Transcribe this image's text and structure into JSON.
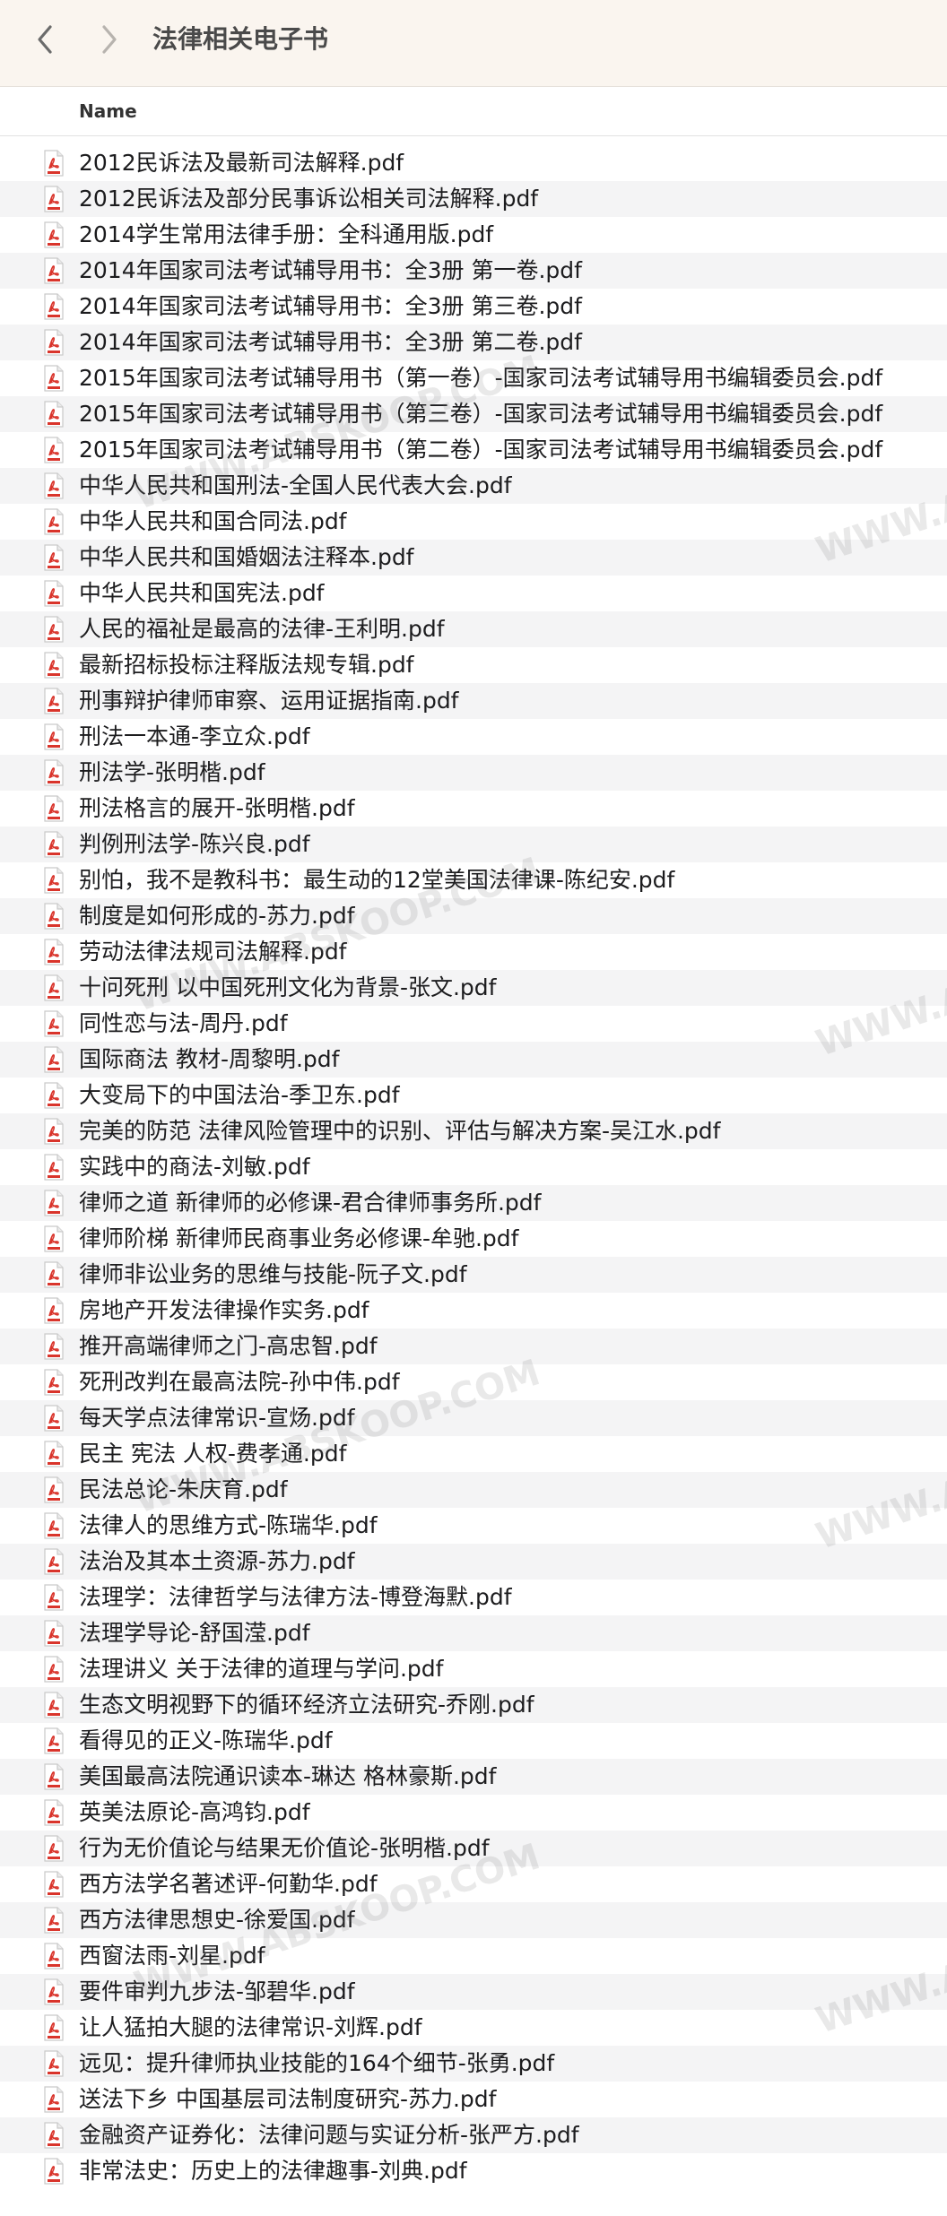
{
  "window": {
    "title": "法律相关电子书"
  },
  "icons": {
    "back": "chevron-left-icon",
    "forward": "chevron-right-icon",
    "file": "pdf-file-icon"
  },
  "colors": {
    "pdf_icon_red": "#d9342b",
    "toolbar_bg": "#faf5ef",
    "row_alt": "#f4f4f5"
  },
  "list_header": {
    "name_label": "Name"
  },
  "files": [
    "2012民诉法及最新司法解释.pdf",
    "2012民诉法及部分民事诉讼相关司法解释.pdf",
    "2014学生常用法律手册：全科通用版.pdf",
    "2014年国家司法考试辅导用书：全3册 第一卷.pdf",
    "2014年国家司法考试辅导用书：全3册 第三卷.pdf",
    "2014年国家司法考试辅导用书：全3册 第二卷.pdf",
    "2015年国家司法考试辅导用书（第一卷）-国家司法考试辅导用书编辑委员会.pdf",
    "2015年国家司法考试辅导用书（第三卷）-国家司法考试辅导用书编辑委员会.pdf",
    "2015年国家司法考试辅导用书（第二卷）-国家司法考试辅导用书编辑委员会.pdf",
    "中华人民共和国刑法-全国人民代表大会.pdf",
    "中华人民共和国合同法.pdf",
    "中华人民共和国婚姻法注释本.pdf",
    "中华人民共和国宪法.pdf",
    "人民的福祉是最高的法律-王利明.pdf",
    "最新招标投标注释版法规专辑.pdf",
    "刑事辩护律师审察、运用证据指南.pdf",
    "刑法一本通-李立众.pdf",
    "刑法学-张明楷.pdf",
    "刑法格言的展开-张明楷.pdf",
    "判例刑法学-陈兴良.pdf",
    "别怕，我不是教科书：最生动的12堂美国法律课-陈纪安.pdf",
    "制度是如何形成的-苏力.pdf",
    "劳动法律法规司法解释.pdf",
    "十问死刑 以中国死刑文化为背景-张文.pdf",
    "同性恋与法-周丹.pdf",
    "国际商法 教材-周黎明.pdf",
    "大变局下的中国法治-季卫东.pdf",
    "完美的防范 法律风险管理中的识别、评估与解决方案-吴江水.pdf",
    "实践中的商法-刘敏.pdf",
    "律师之道 新律师的必修课-君合律师事务所.pdf",
    "律师阶梯 新律师民商事业务必修课-牟驰.pdf",
    "律师非讼业务的思维与技能-阮子文.pdf",
    "房地产开发法律操作实务.pdf",
    "推开高端律师之门-高忠智.pdf",
    "死刑改判在最高法院-孙中伟.pdf",
    "每天学点法律常识-宣炀.pdf",
    "民主 宪法 人权-费孝通.pdf",
    "民法总论-朱庆育.pdf",
    "法律人的思维方式-陈瑞华.pdf",
    "法治及其本土资源-苏力.pdf",
    "法理学：法律哲学与法律方法-博登海默.pdf",
    "法理学导论-舒国滢.pdf",
    "法理讲义 关于法律的道理与学问.pdf",
    "生态文明视野下的循环经济立法研究-乔刚.pdf",
    "看得见的正义-陈瑞华.pdf",
    "美国最高法院通识读本-琳达 格林豪斯.pdf",
    "英美法原论-高鸿钧.pdf",
    "行为无价值论与结果无价值论-张明楷.pdf",
    "西方法学名著述评-何勤华.pdf",
    "西方法律思想史-徐爱国.pdf",
    "西窗法雨-刘星.pdf",
    "要件审判九步法-邹碧华.pdf",
    "让人猛拍大腿的法律常识-刘辉.pdf",
    "远见：提升律师执业技能的164个细节-张勇.pdf",
    "送法下乡 中国基层司法制度研究-苏力.pdf",
    "金融资产证券化：法律问题与实证分析-张严方.pdf",
    "非常法史：历史上的法律趣事-刘典.pdf"
  ],
  "watermark_text": "WWW.ABSKOOP.COM"
}
